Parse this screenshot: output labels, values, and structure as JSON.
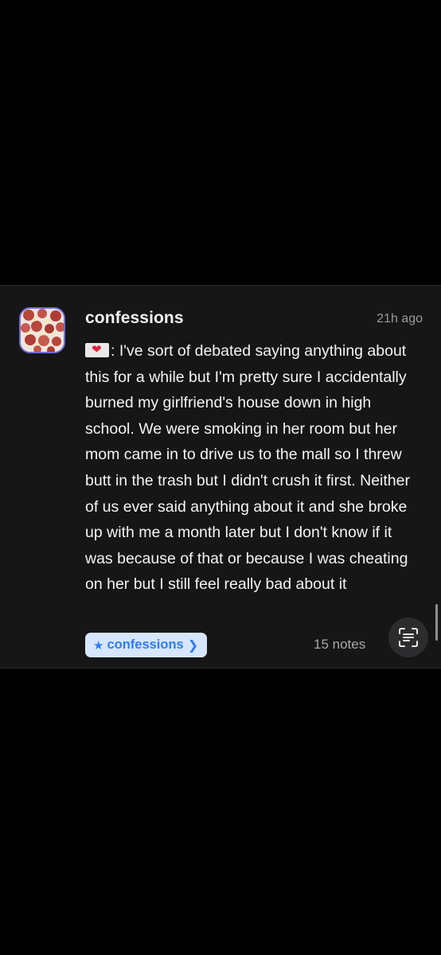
{
  "post": {
    "blog_name": "confessions",
    "timestamp": "21h ago",
    "prefix_icon": "love-letter-icon",
    "body": ": I've sort of debated saying anything about this for a while but I'm pretty sure I accidentally burned my girlfriend's house down in high school. We were smoking in her room but her mom came in to drive us to the mall so I threw butt in the trash but I didn't crush it first. Neither of us ever said anything about it and she broke up with me a month later but I don't know if it was because of that or because I was cheating on her but I still feel really bad about it",
    "tag": {
      "label": "confessions",
      "icon": "star-icon",
      "chevron": "chevron-right-icon"
    },
    "notes": "15 notes",
    "scan_button_icon": "live-text-icon"
  },
  "colors": {
    "background": "#000000",
    "card": "#161616",
    "accent_blue": "#2f7cf6",
    "tag_bg": "#d6e6ff",
    "avatar_border": "#6f6dd6"
  }
}
